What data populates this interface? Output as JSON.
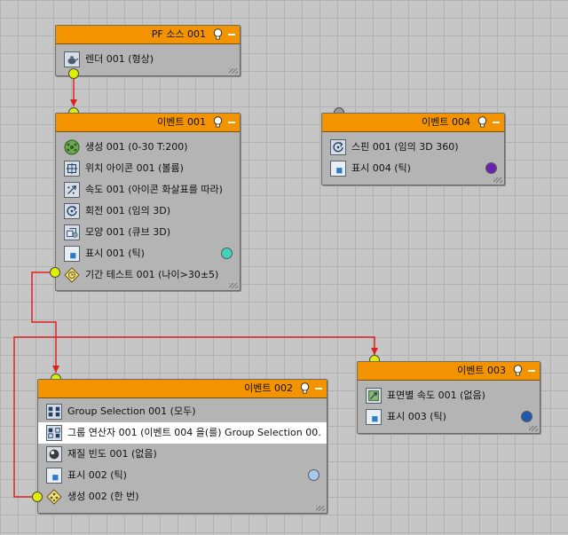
{
  "colors": {
    "header": "#f39300",
    "node_body": "#b4b4b4",
    "port_active": "#dcf000",
    "port_inactive": "#9a9a9a",
    "wire": "#e02020"
  },
  "nodes": {
    "pf_source": {
      "title": "PF 소스 001",
      "rows": [
        {
          "label": "렌더 001 (형상)",
          "icon": "teapot-icon"
        }
      ]
    },
    "event1": {
      "title": "이벤트 001",
      "rows": [
        {
          "label": "생성 001 (0-30 T:200)",
          "icon": "birth-icon"
        },
        {
          "label": "위치 아이콘 001 (볼륨)",
          "icon": "position-icon"
        },
        {
          "label": "속도 001 (아이콘 화살표를 따라)",
          "icon": "speed-icon"
        },
        {
          "label": "회전 001 (임의 3D)",
          "icon": "rotation-icon"
        },
        {
          "label": "모양 001 (큐브 3D)",
          "icon": "shape-icon"
        },
        {
          "label": "표시 001 (틱)",
          "icon": "display-icon",
          "dot": "#3ed6b8"
        },
        {
          "label": "기간 테스트 001 (나이>30±5)",
          "icon": "age-test-icon"
        }
      ]
    },
    "event4": {
      "title": "이벤트 004",
      "rows": [
        {
          "label": "스핀 001 (임의 3D 360)",
          "icon": "spin-icon"
        },
        {
          "label": "표시 004 (틱)",
          "icon": "display-icon",
          "dot": "#6a22b0"
        }
      ]
    },
    "event3": {
      "title": "이벤트 003",
      "rows": [
        {
          "label": "표면별 속도 001 (없음)",
          "icon": "speed-by-surface-icon"
        },
        {
          "label": "표시 003 (틱)",
          "icon": "display-icon",
          "dot": "#2058b0"
        }
      ]
    },
    "event2": {
      "title": "이벤트 002",
      "rows": [
        {
          "label": "Group Selection 001 (모두)",
          "icon": "group-selection-icon"
        },
        {
          "label": "그룹 연산자 001 (이벤트 004 을(를) Group Selection 00...",
          "icon": "group-operator-icon",
          "selected": true
        },
        {
          "label": "재질 빈도 001 (없음)",
          "icon": "material-frequency-icon"
        },
        {
          "label": "표시 002 (틱)",
          "icon": "display-icon",
          "dot": "#a8c8ec"
        },
        {
          "label": "생성 002 (한 번)",
          "icon": "spawn-icon"
        }
      ]
    }
  }
}
